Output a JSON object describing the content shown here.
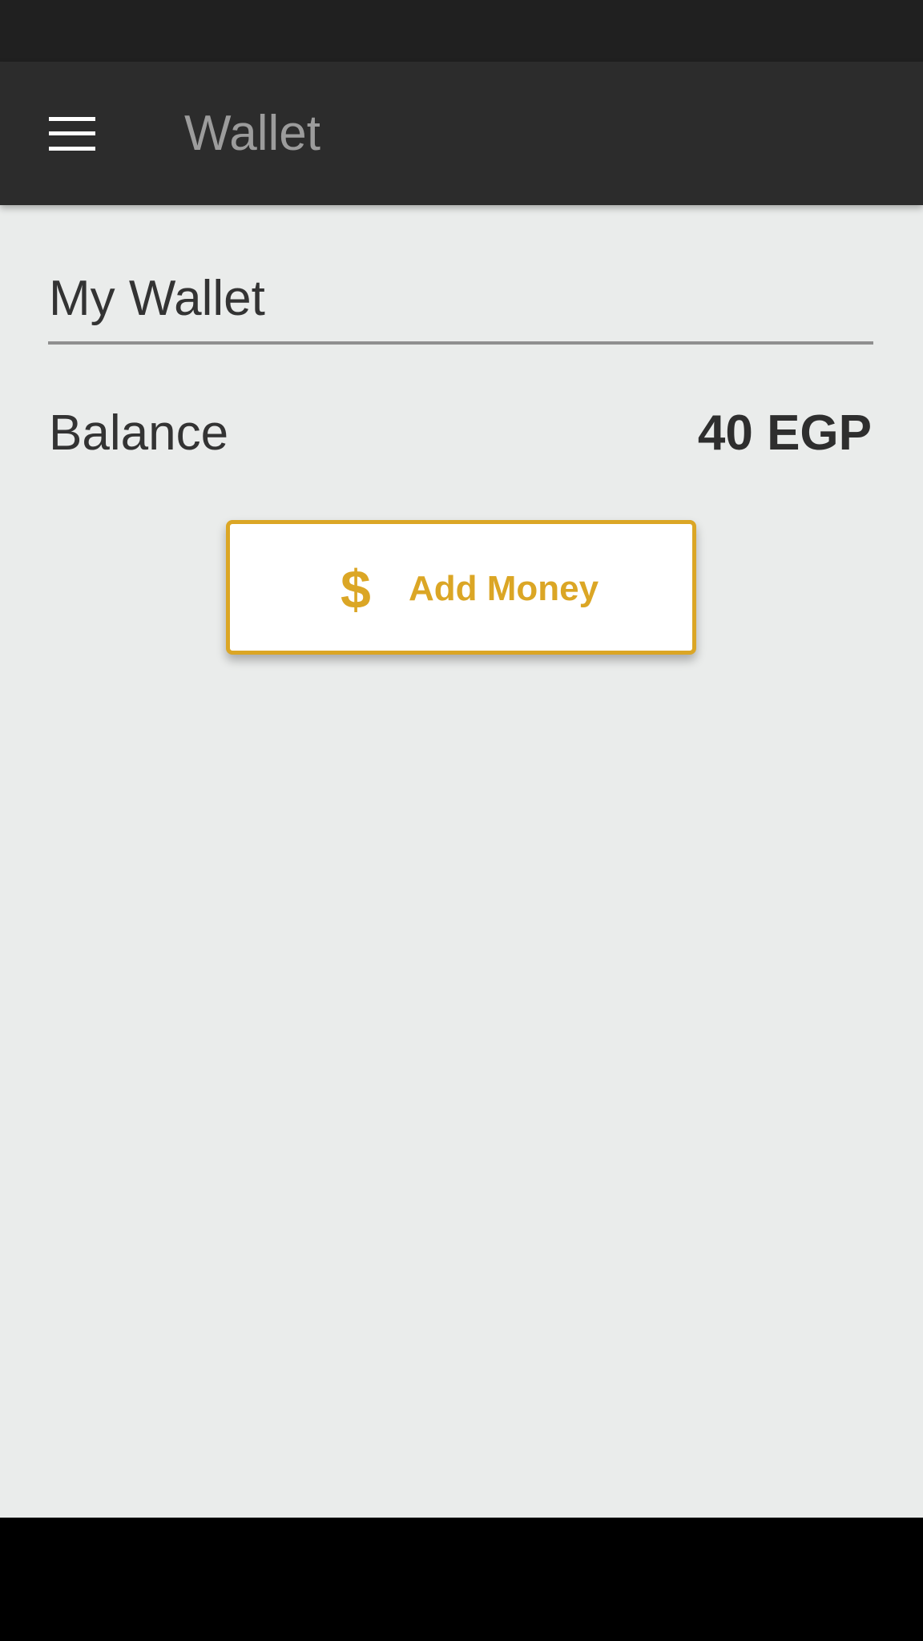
{
  "app_bar": {
    "title": "Wallet",
    "menu_icon": "menu-icon"
  },
  "wallet": {
    "name": "My Wallet",
    "balance_label": "Balance",
    "balance_value": "40 EGP"
  },
  "actions": {
    "add_money_label": "Add Money",
    "add_money_icon": "$"
  },
  "colors": {
    "status_bar": "#202020",
    "app_bar": "#2c2c2c",
    "background": "#eaeceb",
    "accent": "#dba625",
    "nav_bar": "#000000"
  }
}
